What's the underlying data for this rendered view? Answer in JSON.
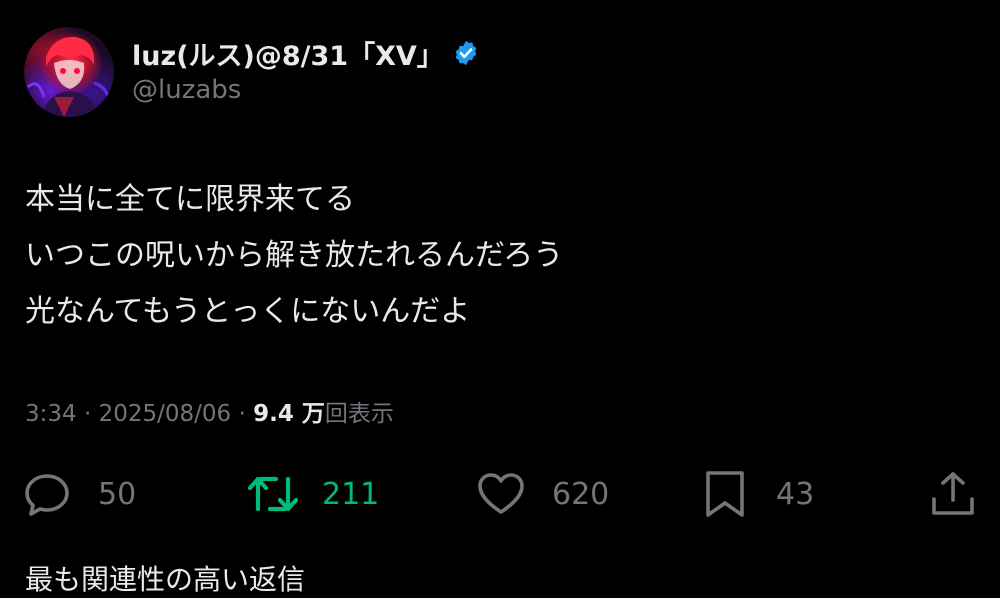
{
  "author": {
    "display_name": "luz(ルス)@8/31「XV」",
    "handle": "@luzabs",
    "verified": true
  },
  "tweet": {
    "lines": [
      "本当に全てに限界来てる",
      "いつこの呪いから解き放たれるんだろう",
      "光なんてもうとっくにないんだよ"
    ]
  },
  "meta": {
    "time": "3:34",
    "separator": " · ",
    "date": "2025/08/06",
    "views_count": "9.4 万",
    "views_label": "回表示"
  },
  "actions": {
    "reply": {
      "count": "50",
      "icon": "reply-bubble-icon"
    },
    "retweet": {
      "count": "211",
      "icon": "retweet-icon",
      "active": true
    },
    "like": {
      "count": "620",
      "icon": "heart-icon"
    },
    "bookmark": {
      "count": "43",
      "icon": "bookmark-icon"
    },
    "share": {
      "icon": "share-upload-icon"
    }
  },
  "footer_cutoff_text": "最も関連性の高い返信",
  "colors": {
    "background": "#000000",
    "primary_text": "#e7e9ea",
    "secondary_text": "#71767b",
    "retweet_green": "#00ba7c",
    "verified_blue": "#1d9bf0"
  }
}
